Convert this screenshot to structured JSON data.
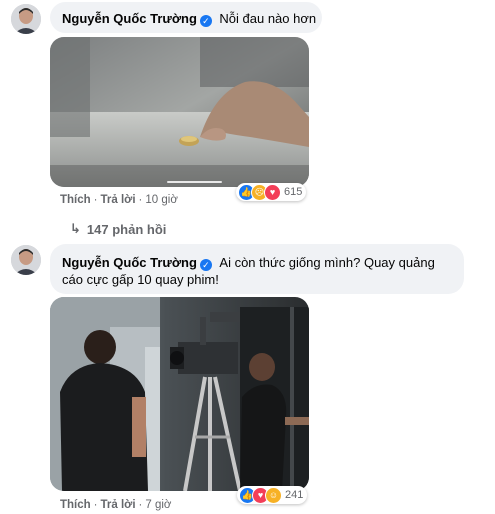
{
  "comments": [
    {
      "author": "Nguyễn Quốc Trường",
      "text": "Nỗi đau nào hơn",
      "like_label": "Thích",
      "reply_label": "Trả lời",
      "time": "10 giờ",
      "reaction_count": "615",
      "reactions": [
        "like-icon",
        "sad-icon",
        "love-icon"
      ],
      "replies_label": "147 phản hồi"
    },
    {
      "author": "Nguyễn Quốc Trường",
      "text_line1": "Ai còn thức giống mình? Quay quảng",
      "text_line2": "cáo cực gấp 10 quay phim!",
      "like_label": "Thích",
      "reply_label": "Trả lời",
      "time": "7 giờ",
      "reaction_count": "241",
      "reactions": [
        "like-icon",
        "love-icon",
        "haha-icon"
      ]
    }
  ],
  "colors": {
    "bubble_bg": "#f0f2f5",
    "meta_text": "#65676b",
    "like_blue": "#1877f2",
    "love_red": "#f33e58",
    "emoji_yellow": "#f7b125"
  }
}
